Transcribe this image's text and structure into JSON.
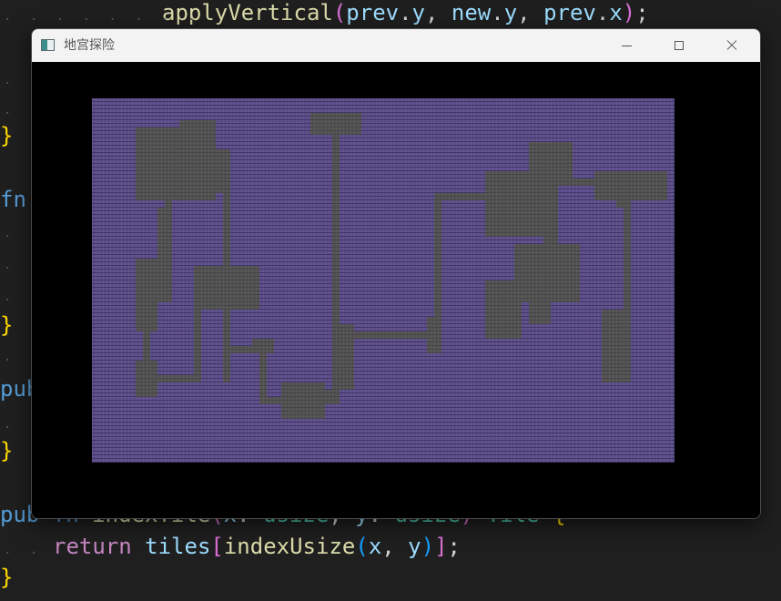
{
  "editor": {
    "lines": [
      {
        "indent": "        ",
        "parts": [
          {
            "t": "applyVertical",
            "c": "fncall"
          },
          {
            "t": "(",
            "c": "paren2"
          },
          {
            "t": "prev",
            "c": "ident"
          },
          {
            "t": ".",
            "c": ""
          },
          {
            "t": "y",
            "c": "ident"
          },
          {
            "t": ", ",
            "c": ""
          },
          {
            "t": "new",
            "c": "ident"
          },
          {
            "t": ".",
            "c": ""
          },
          {
            "t": "y",
            "c": "ident"
          },
          {
            "t": ", ",
            "c": ""
          },
          {
            "t": "prev",
            "c": "ident"
          },
          {
            "t": ".",
            "c": ""
          },
          {
            "t": "x",
            "c": "ident"
          },
          {
            "t": ")",
            "c": "paren2"
          },
          {
            "t": ";",
            "c": ""
          }
        ]
      },
      {
        "indent": "",
        "parts": [
          {
            "t": "}",
            "c": "brace"
          }
        ]
      },
      {
        "indent": "",
        "parts": [
          {
            "t": "fn",
            "c": "fnk"
          }
        ]
      },
      {
        "indent": "",
        "parts": [
          {
            "t": "}",
            "c": "brace"
          }
        ]
      },
      {
        "indent": "",
        "parts": [
          {
            "t": "pub",
            "c": "fnk"
          }
        ]
      },
      {
        "indent": "",
        "parts": [
          {
            "t": "}",
            "c": "brace"
          }
        ]
      },
      {
        "indent": "",
        "parts": [
          {
            "t": "pub",
            "c": "fnk"
          },
          {
            "t": " ",
            "c": ""
          },
          {
            "t": "fn",
            "c": "fnk"
          },
          {
            "t": " ",
            "c": ""
          },
          {
            "t": "indexTile",
            "c": "fncall"
          },
          {
            "t": "(",
            "c": "paren2"
          },
          {
            "t": "x",
            "c": "ident"
          },
          {
            "t": ": ",
            "c": ""
          },
          {
            "t": "usize",
            "c": "typ"
          },
          {
            "t": ", ",
            "c": ""
          },
          {
            "t": "y",
            "c": "ident"
          },
          {
            "t": ": ",
            "c": ""
          },
          {
            "t": "usize",
            "c": "typ"
          },
          {
            "t": ")",
            "c": "paren2"
          },
          {
            "t": " ",
            "c": ""
          },
          {
            "t": "Tile",
            "c": "typ"
          },
          {
            "t": " {",
            "c": "brace"
          }
        ]
      },
      {
        "indent": "    ",
        "parts": [
          {
            "t": "return",
            "c": "kw"
          },
          {
            "t": " ",
            "c": ""
          },
          {
            "t": "tiles",
            "c": "ident"
          },
          {
            "t": "[",
            "c": "paren2"
          },
          {
            "t": "indexUsize",
            "c": "fncall"
          },
          {
            "t": "(",
            "c": "paren3"
          },
          {
            "t": "x",
            "c": "ident"
          },
          {
            "t": ", ",
            "c": ""
          },
          {
            "t": "y",
            "c": "ident"
          },
          {
            "t": ")",
            "c": "paren3"
          },
          {
            "t": "]",
            "c": "paren2"
          },
          {
            "t": ";",
            "c": ""
          }
        ]
      },
      {
        "indent": "",
        "parts": [
          {
            "t": "}",
            "c": "brace"
          }
        ]
      }
    ]
  },
  "window": {
    "title": "地宫探险",
    "controls": {
      "minimize": "minimize-icon",
      "maximize": "maximize-icon",
      "close": "close-icon"
    }
  },
  "game": {
    "wall_color": "#5c4e88",
    "floor_color": "#525252",
    "background_color": "#000000"
  }
}
